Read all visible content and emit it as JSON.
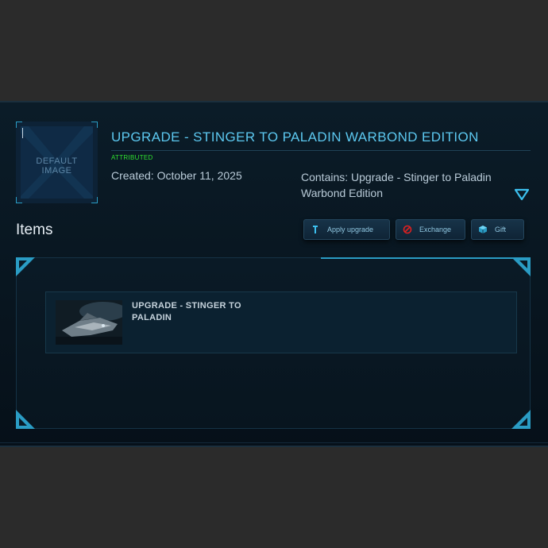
{
  "pledge": {
    "thumbnail_text": "DEFAULT\nIMAGE",
    "title": "UPGRADE - STINGER TO PALADIN WARBOND EDITION",
    "status": "ATTRIBUTED",
    "created": "Created: October 11, 2025",
    "contains": "Contains: Upgrade - Stinger to Paladin Warbond Edition"
  },
  "items_section": {
    "heading": "Items",
    "buttons": {
      "apply_upgrade": "Apply upgrade",
      "exchange": "Exchange",
      "gift": "Gift"
    },
    "items": [
      {
        "title": "UPGRADE - STINGER TO PALADIN"
      }
    ]
  },
  "colors": {
    "accent": "#5cc8f0",
    "status_green": "#2fe02f",
    "frame_cyan": "#2a9cc4",
    "exchange_red": "#e02020"
  },
  "icons": {
    "expand": "triangle-down-icon",
    "apply_upgrade": "wrench-icon",
    "exchange": "no-entry-icon",
    "gift": "cube-icon"
  }
}
